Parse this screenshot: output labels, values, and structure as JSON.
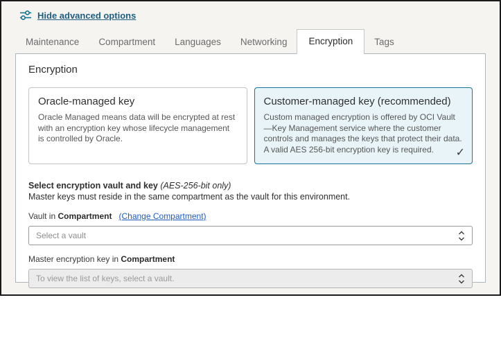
{
  "advanced_options": {
    "label": "Hide advanced options"
  },
  "tabs": [
    {
      "label": "Maintenance"
    },
    {
      "label": "Compartment"
    },
    {
      "label": "Languages"
    },
    {
      "label": "Networking"
    },
    {
      "label": "Encryption"
    },
    {
      "label": "Tags"
    }
  ],
  "panel": {
    "heading": "Encryption",
    "cards": [
      {
        "title": "Oracle-managed key",
        "description": "Oracle Managed means data will be encrypted at rest with an encryption key whose lifecycle management is controlled by Oracle.",
        "selected": false
      },
      {
        "title": "Customer-managed key (recommended)",
        "description": "Custom managed encryption is offered by OCI Vault—Key Management service where the customer controls and manages the keys that protect their data. A valid AES 256-bit encryption key is required.",
        "selected": true,
        "check_glyph": "✓"
      }
    ],
    "vault_section": {
      "heading_bold": "Select encryption vault and key",
      "heading_italic": " (AES-256-bit only)",
      "subtext": "Master keys must reside in the same compartment as the vault for this environment.",
      "vault_label_prefix": "Vault in ",
      "vault_label_bold": "Compartment",
      "change_compartment_link": "(Change Compartment)",
      "vault_select_placeholder": "Select a vault",
      "key_label_prefix": "Master encryption key in ",
      "key_label_bold": "Compartment",
      "key_select_placeholder": "To view the list of keys, select a vault."
    }
  },
  "colors": {
    "accent_blue": "#15749c",
    "selected_card_bg": "#e9f4f9",
    "advanced_link": "#1d5e80",
    "compartment_link": "#1d5bbd",
    "frame_border": "#1a1a1a"
  }
}
